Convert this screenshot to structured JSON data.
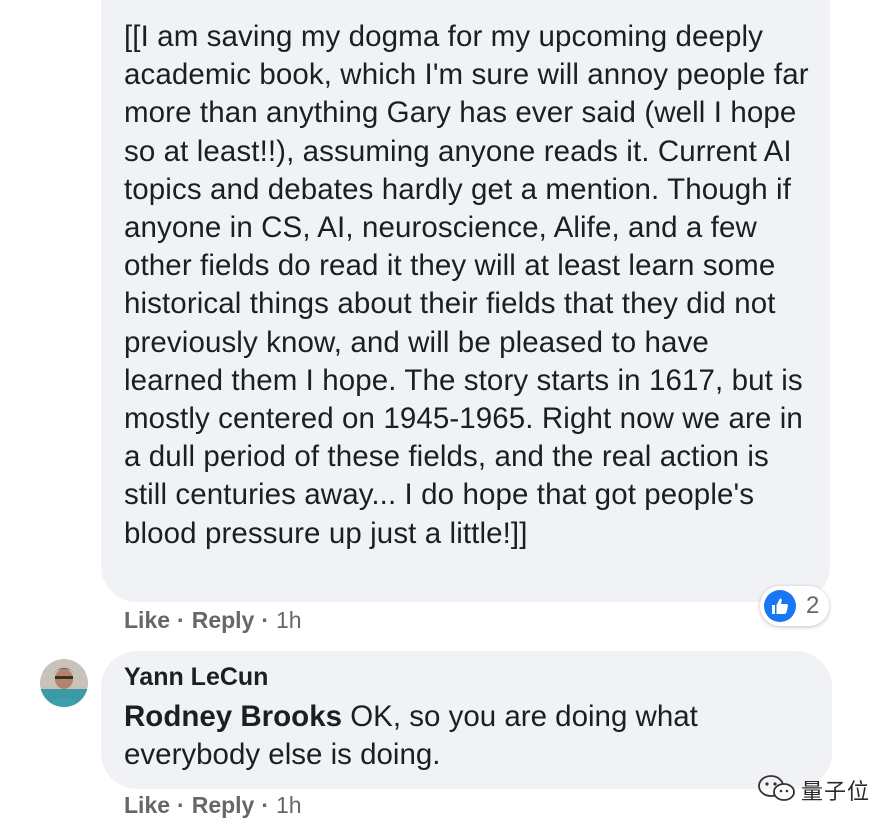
{
  "comment1": {
    "text": "[[I am saving my dogma for my upcoming deeply academic book, which I'm sure will annoy people far more than anything Gary has ever said (well I hope so at least!!), assuming anyone reads it. Current AI topics and debates hardly get a mention. Though if anyone in CS, AI, neuroscience, Alife, and a few other fields do read it they will at least learn some historical things about their fields that they did not previously know, and will be pleased to have learned them I hope. The story starts in 1617, but is mostly centered on 1945-1965. Right now we are in a dull period of these fields, and the real action is still centuries away... I do hope that got people's blood pressure up just a little!]]",
    "like_label": "Like",
    "reply_label": "Reply",
    "separator": "·",
    "time": "1h",
    "reaction_icon": "thumbs-up-icon",
    "reaction_count": "2"
  },
  "comment2": {
    "author": "Yann LeCun",
    "mention": "Rodney Brooks",
    "text": " OK, so you are doing what everybody else is doing.",
    "like_label": "Like",
    "reply_label": "Reply",
    "separator": "·",
    "time": "1h"
  },
  "watermark": {
    "text": "量子位"
  },
  "colors": {
    "bubble": "#f0f2f5",
    "text": "#1c1e21",
    "meta": "#65676b",
    "like_blue": "#1877f2"
  }
}
